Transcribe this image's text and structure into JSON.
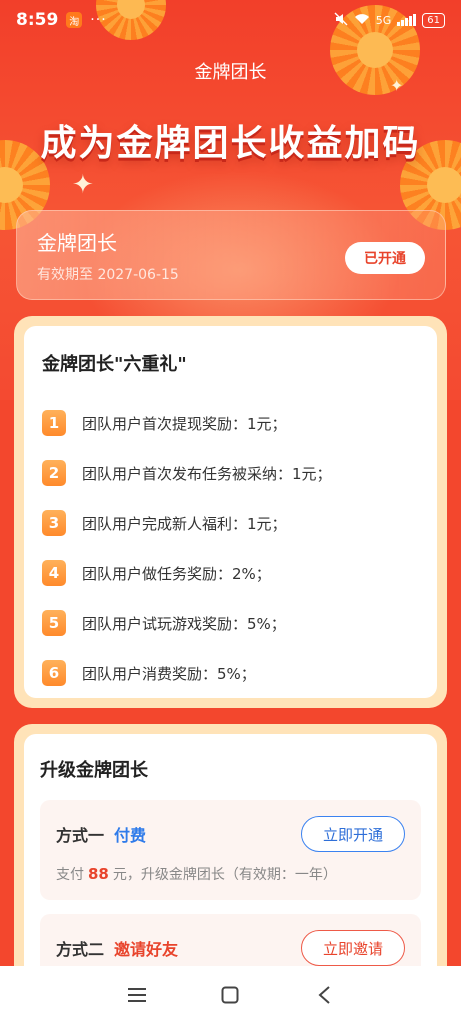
{
  "status_bar": {
    "time": "8:59",
    "app_badge": "淘",
    "more": "···",
    "network": "5G",
    "battery": "61"
  },
  "header": {
    "title": "金牌团长",
    "heading": "成为金牌团长收益加码"
  },
  "membership": {
    "name": "金牌团长",
    "expiry": "有效期至 2027-06-15",
    "status_button": "已开通"
  },
  "gifts": {
    "title": "金牌团长\"六重礼\"",
    "items": [
      {
        "num": "1",
        "text": "团队用户首次提现奖励：1元；"
      },
      {
        "num": "2",
        "text": "团队用户首次发布任务被采纳：1元；"
      },
      {
        "num": "3",
        "text": "团队用户完成新人福利：1元；"
      },
      {
        "num": "4",
        "text": "团队用户做任务奖励：2%；"
      },
      {
        "num": "5",
        "text": "团队用户试玩游戏奖励：5%；"
      },
      {
        "num": "6",
        "text": "团队用户消费奖励：5%；"
      }
    ]
  },
  "upgrade": {
    "title": "升级金牌团长",
    "option1": {
      "label": "方式一",
      "type": "付费",
      "button": "立即开通",
      "desc_prefix": "支付",
      "price": "88",
      "desc_suffix": "元，升级金牌团长（有效期：一年）"
    },
    "option2": {
      "label": "方式二",
      "type": "邀请好友",
      "button": "立即邀请"
    }
  },
  "colors": {
    "brand_red": "#f3472d",
    "accent_orange": "#ff8a2b",
    "link_blue": "#2f7bea"
  },
  "icons": {
    "nav_menu": "menu-icon",
    "nav_home": "home-icon",
    "nav_back": "back-icon"
  }
}
